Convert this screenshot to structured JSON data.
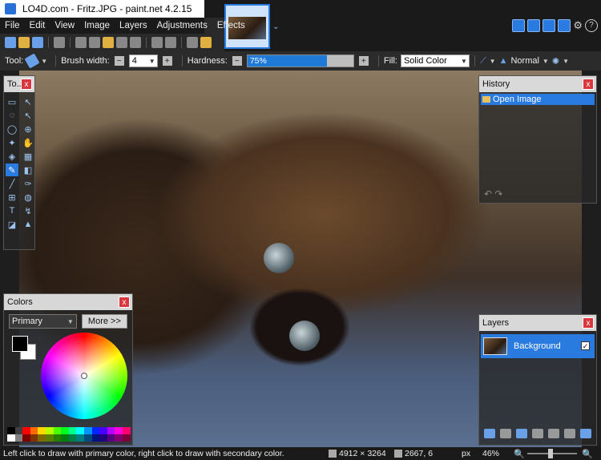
{
  "window": {
    "title": "LO4D.com - Fritz.JPG - paint.net 4.2.15",
    "minimize": "—",
    "maximize": "☐",
    "close": "✕"
  },
  "menu": [
    "File",
    "Edit",
    "View",
    "Image",
    "Layers",
    "Adjustments",
    "Effects"
  ],
  "tab": {
    "dropdown_glyph": "⌄"
  },
  "tool_options": {
    "tool_label": "Tool:",
    "brush_width_label": "Brush width:",
    "brush_width_value": "4",
    "hardness_label": "Hardness:",
    "hardness_value": "75%",
    "hardness_fraction": 0.75,
    "fill_label": "Fill:",
    "fill_value": "Solid Color",
    "blend_mode": "Normal"
  },
  "tools_panel": {
    "title": "To...",
    "close": "x",
    "tools": [
      "▭",
      "↖",
      "◌",
      "↖",
      "◯",
      "⊕",
      "✦",
      "✋",
      "◈",
      "▦",
      "✎",
      "◧",
      "╱",
      "✑",
      "⊞",
      "◍",
      "T",
      "↯",
      "◪",
      "▲"
    ]
  },
  "history_panel": {
    "title": "History",
    "close": "x",
    "items": [
      "Open Image"
    ],
    "undo": "↶ ↷"
  },
  "colors_panel": {
    "title": "Colors",
    "close": "x",
    "mode": "Primary",
    "more_button": "More >>",
    "primary_color": "#000000",
    "secondary_color": "#ffffff",
    "palette": [
      "#000000",
      "#404040",
      "#ff0000",
      "#ff6a00",
      "#ffd800",
      "#b6ff00",
      "#4cff00",
      "#00ff21",
      "#00ff90",
      "#00ffff",
      "#0094ff",
      "#0026ff",
      "#4800ff",
      "#b200ff",
      "#ff00dc",
      "#ff006e",
      "#ffffff",
      "#808080",
      "#7f0000",
      "#7f3300",
      "#7f6a00",
      "#5b7f00",
      "#267f00",
      "#007f0e",
      "#007f46",
      "#007f7f",
      "#004a7f",
      "#00137f",
      "#21007f",
      "#57007f",
      "#7f006e",
      "#7f0037"
    ]
  },
  "layers_panel": {
    "title": "Layers",
    "close": "x",
    "layers": [
      {
        "name": "Background",
        "visible": "✓"
      }
    ]
  },
  "status": {
    "hint": "Left click to draw with primary color, right click to draw with secondary color.",
    "image_size": "4912 × 3264",
    "cursor_pos": "2667, 6",
    "unit": "px",
    "zoom": "46%"
  }
}
